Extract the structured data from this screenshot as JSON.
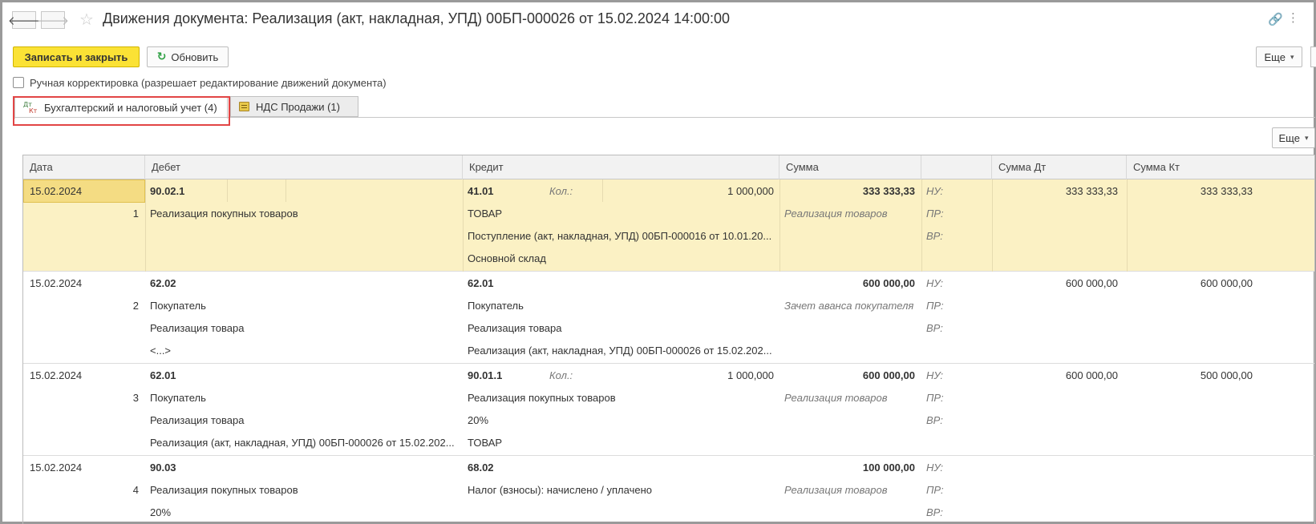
{
  "window": {
    "title": "Движения документа: Реализация (акт, накладная, УПД) 00БП-000026 от 15.02.2024 14:00:00",
    "back_glyph": "🡐",
    "forward_glyph": "🡒",
    "star_glyph": "☆",
    "link_glyph": "🔗",
    "more_glyph": "⋮"
  },
  "toolbar": {
    "save_close_label": "Записать и закрыть",
    "refresh_label": "Обновить",
    "refresh_glyph": "↻",
    "more_label": "Еще",
    "caret": "▾"
  },
  "manual_edit": {
    "label": "Ручная корректировка (разрешает редактирование движений документа)",
    "checked": false
  },
  "tabs": [
    {
      "label": "Бухгалтерский и налоговый учет (4)",
      "active": true,
      "icon_dt": "Дт",
      "icon_kt": "Кт"
    },
    {
      "label": "НДС Продажи (1)",
      "active": false
    }
  ],
  "table_toolbar": {
    "more_label": "Еще",
    "caret": "▾"
  },
  "columns": [
    "Дата",
    "Дебет",
    "Кредит",
    "Сумма",
    "",
    "Сумма Дт",
    "Сумма Кт"
  ],
  "rows": [
    {
      "date": "15.02.2024",
      "num": "1",
      "selected": true,
      "debit_account": "90.02.1",
      "debit_lines": [
        "Реализация покупных товаров",
        "",
        ""
      ],
      "credit_account": "41.01",
      "credit_qty_label": "Кол.:",
      "credit_qty": "1 000,000",
      "credit_lines": [
        "ТОВАР",
        "Поступление (акт, накладная, УПД) 00БП-000016 от 10.01.20...",
        "Основной склад"
      ],
      "amount": "333 333,33",
      "content": "Реализация товаров",
      "kinds": [
        "НУ:",
        "ПР:",
        "ВР:"
      ],
      "sum_dt": "333 333,33",
      "sum_kt": "333 333,33"
    },
    {
      "date": "15.02.2024",
      "num": "2",
      "selected": false,
      "debit_account": "62.02",
      "debit_lines": [
        "Покупатель",
        "Реализация товара",
        "<...>"
      ],
      "credit_account": "62.01",
      "credit_qty_label": "",
      "credit_qty": "",
      "credit_lines": [
        "Покупатель",
        "Реализация товара",
        "Реализация (акт, накладная, УПД) 00БП-000026 от 15.02.202..."
      ],
      "amount": "600 000,00",
      "content": "Зачет аванса покупателя",
      "kinds": [
        "НУ:",
        "ПР:",
        "ВР:"
      ],
      "sum_dt": "600 000,00",
      "sum_kt": "600 000,00"
    },
    {
      "date": "15.02.2024",
      "num": "3",
      "selected": false,
      "debit_account": "62.01",
      "debit_lines": [
        "Покупатель",
        "Реализация товара",
        "Реализация (акт, накладная, УПД) 00БП-000026 от 15.02.202..."
      ],
      "credit_account": "90.01.1",
      "credit_qty_label": "Кол.:",
      "credit_qty": "1 000,000",
      "credit_lines": [
        "Реализация покупных товаров",
        "20%",
        "ТОВАР"
      ],
      "amount": "600 000,00",
      "content": "Реализация товаров",
      "kinds": [
        "НУ:",
        "ПР:",
        "ВР:"
      ],
      "sum_dt": "600 000,00",
      "sum_kt": "500 000,00"
    },
    {
      "date": "15.02.2024",
      "num": "4",
      "selected": false,
      "debit_account": "90.03",
      "debit_lines": [
        "Реализация покупных товаров",
        "20%",
        ""
      ],
      "credit_account": "68.02",
      "credit_qty_label": "",
      "credit_qty": "",
      "credit_lines": [
        "Налог (взносы): начислено / уплачено",
        "",
        ""
      ],
      "amount": "100 000,00",
      "content": "Реализация товаров",
      "kinds": [
        "НУ:",
        "ПР:",
        "ВР:"
      ],
      "sum_dt": "",
      "sum_kt": ""
    }
  ]
}
